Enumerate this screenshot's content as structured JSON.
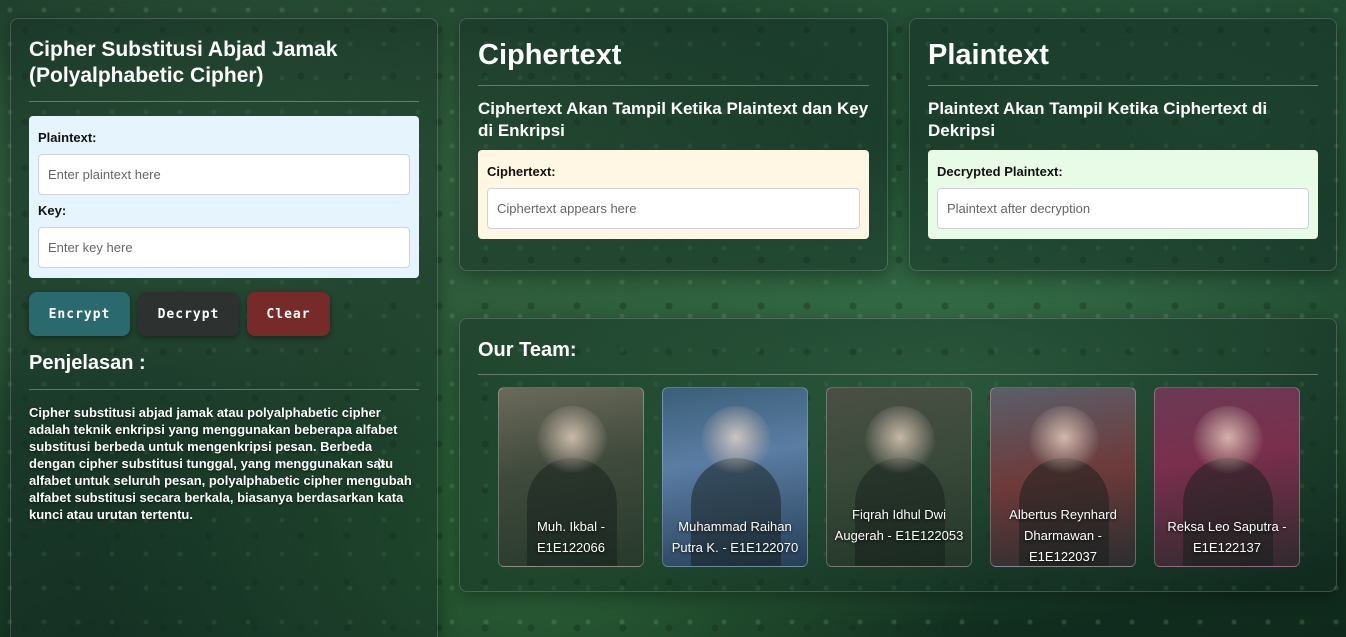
{
  "left_panel": {
    "title": "Cipher Substitusi Abjad Jamak (Polyalphabetic Cipher)",
    "plaintext_label": "Plaintext:",
    "plaintext_placeholder": "Enter plaintext here",
    "key_label": "Key:",
    "key_placeholder": "Enter key here",
    "buttons": {
      "encrypt": "Encrypt",
      "decrypt": "Decrypt",
      "clear": "Clear"
    },
    "explanation_title": "Penjelasan :",
    "explanation_text": "Cipher substitusi abjad jamak atau polyalphabetic cipher adalah teknik enkripsi yang menggunakan beberapa alfabet substitusi berbeda untuk mengenkripsi pesan. Berbeda dengan cipher substitusi tunggal, yang menggunakan satu alfabet untuk seluruh pesan, polyalphabetic cipher mengubah alfabet substitusi secara berkala, biasanya berdasarkan kata kunci atau urutan tertentu."
  },
  "ciphertext_panel": {
    "title": "Ciphertext",
    "subtitle": "Ciphertext Akan Tampil Ketika Plaintext dan Key di Enkripsi",
    "label": "Ciphertext:",
    "placeholder": "Ciphertext appears here"
  },
  "plaintext_panel": {
    "title": "Plaintext",
    "subtitle": "Plaintext Akan Tampil Ketika Ciphertext di Dekripsi",
    "label": "Decrypted Plaintext:",
    "placeholder": "Plaintext after decryption"
  },
  "team": {
    "title": "Our Team:",
    "members": [
      {
        "name": "Muh. Ikbal - E1E122066"
      },
      {
        "name": "Muhammad Raihan Putra K. - E1E122070"
      },
      {
        "name": "Fiqrah Idhul Dwi Augerah - E1E122053"
      },
      {
        "name": "Albertus Reynhard Dharmawan - E1E122037"
      },
      {
        "name": "Reksa Leo Saputra - E1E122137"
      }
    ]
  },
  "icons": {
    "carousel_next": "chevron-right-icon"
  }
}
